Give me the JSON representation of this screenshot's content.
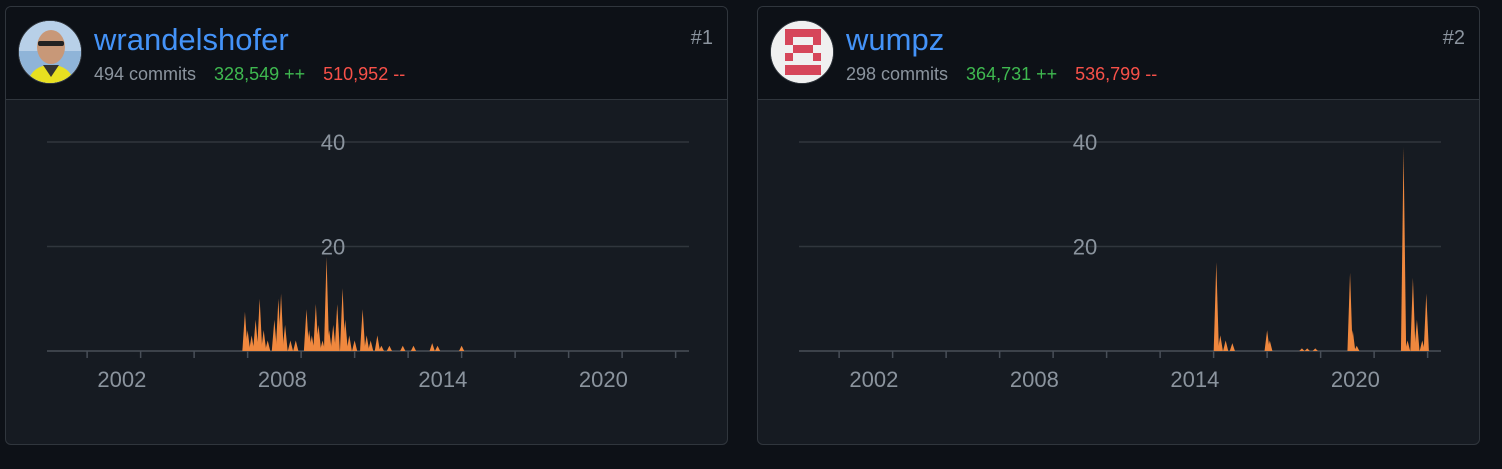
{
  "contributors": [
    {
      "username": "wrandelshofer",
      "commits": "494 commits",
      "additions": "328,549 ++",
      "deletions": "510,952 --",
      "rank": "#1",
      "avatar": "person-photo-avatar"
    },
    {
      "username": "wumpz",
      "commits": "298 commits",
      "additions": "364,731 ++",
      "deletions": "536,799 --",
      "rank": "#2",
      "avatar": "identicon-avatar"
    }
  ],
  "colors": {
    "background": "#0d1117",
    "card": "#161b22",
    "border": "#30363d",
    "link": "#4493f8",
    "muted": "#8b949e",
    "additions": "#3fb950",
    "deletions": "#f85149",
    "series": "#f0883e",
    "gridline": "#30363d"
  },
  "chart_data": [
    {
      "type": "area",
      "ylim": [
        0,
        40
      ],
      "yticks": [
        "40",
        "20"
      ],
      "xlim": [
        1999.5,
        2023.5
      ],
      "xticks": [
        "2002",
        "2008",
        "2014",
        "2020"
      ],
      "grid": true,
      "series": [
        {
          "x": [
            2006.9,
            2007.0,
            2007.15,
            2007.3,
            2007.45,
            2007.6,
            2007.75,
            2008.0,
            2008.15,
            2008.25,
            2008.4,
            2008.6,
            2008.8,
            2009.2,
            2009.3,
            2009.4,
            2009.55,
            2009.65,
            2009.8,
            2009.95,
            2010.05,
            2010.2,
            2010.35,
            2010.55,
            2010.65,
            2010.8,
            2011.0,
            2011.3,
            2011.45,
            2011.6,
            2011.85,
            2012.0,
            2012.3,
            2012.8,
            2013.2,
            2013.9,
            2014.1,
            2015.0
          ],
          "values": [
            7.5,
            4,
            3,
            6,
            10,
            4,
            2,
            6,
            10,
            11,
            5,
            2,
            2,
            8,
            4,
            3,
            9,
            5,
            2,
            18,
            4,
            5,
            9,
            12,
            6,
            3,
            2,
            8,
            3,
            2,
            3,
            1,
            1,
            1,
            1,
            1.5,
            1,
            1
          ]
        }
      ]
    },
    {
      "type": "area",
      "ylim": [
        0,
        40
      ],
      "yticks": [
        "40",
        "20"
      ],
      "xlim": [
        1999.5,
        2023.5
      ],
      "xticks": [
        "2002",
        "2008",
        "2014",
        "2020"
      ],
      "grid": true,
      "series": [
        {
          "x": [
            2015.1,
            2015.25,
            2015.45,
            2015.7,
            2017.0,
            2017.1,
            2018.3,
            2018.5,
            2018.8,
            2020.1,
            2020.2,
            2020.35,
            2022.1,
            2022.25,
            2022.45,
            2022.6,
            2022.8,
            2022.95
          ],
          "values": [
            17,
            3,
            2,
            1.5,
            4,
            2,
            0.5,
            0.5,
            0.5,
            15,
            4,
            1,
            39,
            2,
            14,
            6,
            2,
            11
          ]
        }
      ]
    }
  ]
}
